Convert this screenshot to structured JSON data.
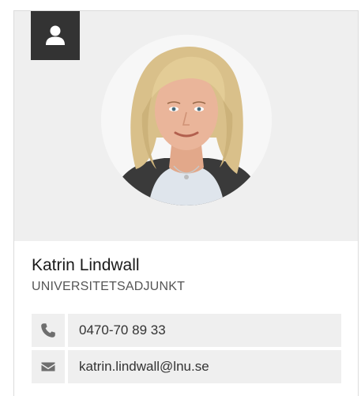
{
  "person": {
    "name": "Katrin Lindwall",
    "title": "UNIVERSITETSADJUNKT",
    "phone": "0470-70 89 33",
    "email": "katrin.lindwall@lnu.se"
  },
  "icons": {
    "badge": "user-icon",
    "phone": "phone-icon",
    "email": "envelope-icon"
  },
  "colors": {
    "badge_background": "#333333",
    "panel_background": "#efefef",
    "icon_color": "#6e6e6e"
  }
}
